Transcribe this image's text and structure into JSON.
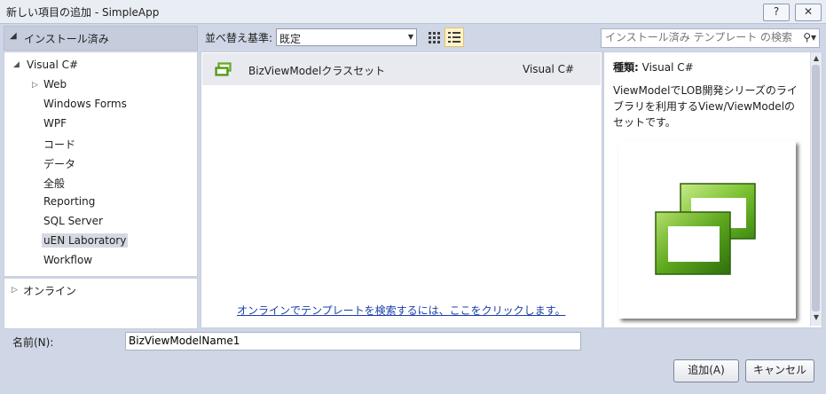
{
  "window": {
    "title": "新しい項目の追加 - SimpleApp",
    "help_label": "?",
    "close_label": "✕"
  },
  "left": {
    "installed_label": "インストール済み",
    "language": "Visual C#",
    "items": [
      {
        "label": "Web"
      },
      {
        "label": "Windows Forms"
      },
      {
        "label": "WPF"
      },
      {
        "label": "コード"
      },
      {
        "label": "データ"
      },
      {
        "label": "全般"
      },
      {
        "label": "Reporting"
      },
      {
        "label": "SQL Server"
      },
      {
        "label": "uEN Laboratory"
      },
      {
        "label": "Workflow"
      }
    ],
    "selected_item": "uEN Laboratory",
    "online_label": "オンライン"
  },
  "toolbar": {
    "sort_label": "並べ替え基準:",
    "sort_value": "既定",
    "search_placeholder": "インストール済み テンプレート の検索"
  },
  "templates": {
    "items": [
      {
        "name": "BizViewModelクラスセット",
        "language": "Visual C#"
      }
    ],
    "online_link": "オンラインでテンプレートを検索するには、ここをクリックします。"
  },
  "details": {
    "type_key": "種類:",
    "type_value": "Visual C#",
    "description": "ViewModelでLOB開発シリーズのライブラリを利用するView/ViewModelのセットです。"
  },
  "footer": {
    "name_label": "名前(N):",
    "name_value": "BizViewModelName1",
    "add_label": "追加(A)",
    "cancel_label": "キャンセル"
  },
  "colors": {
    "accent_green": "#6fb526",
    "link_blue": "#1a3fa8"
  }
}
